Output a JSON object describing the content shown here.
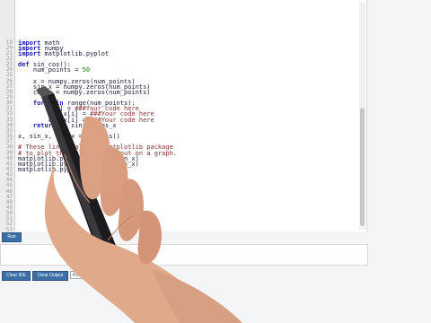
{
  "editor": {
    "lines": [
      {
        "n": "19",
        "parts": [
          {
            "t": "import",
            "k": "kw"
          },
          {
            "t": " math"
          }
        ]
      },
      {
        "n": "20",
        "parts": [
          {
            "t": "import",
            "k": "kw"
          },
          {
            "t": " numpy"
          }
        ]
      },
      {
        "n": "21",
        "parts": [
          {
            "t": "import",
            "k": "kw"
          },
          {
            "t": " matplotlib.pyplot"
          }
        ]
      },
      {
        "n": "22",
        "parts": []
      },
      {
        "n": "23",
        "parts": [
          {
            "t": "def",
            "k": "kw"
          },
          {
            "t": " sin_cos():"
          }
        ]
      },
      {
        "n": "24",
        "parts": [
          {
            "t": "    num_points = "
          },
          {
            "t": "50",
            "k": "num"
          }
        ]
      },
      {
        "n": "25",
        "parts": []
      },
      {
        "n": "26",
        "parts": [
          {
            "t": "    x = numpy.zeros(num_points)"
          }
        ]
      },
      {
        "n": "27",
        "parts": [
          {
            "t": "    sin_x = numpy.zeros(num_points)"
          }
        ]
      },
      {
        "n": "28",
        "parts": [
          {
            "t": "    cos_x = numpy.zeros(num_points)"
          }
        ]
      },
      {
        "n": "29",
        "parts": []
      },
      {
        "n": "30",
        "parts": [
          {
            "t": "    "
          },
          {
            "t": "for",
            "k": "kw"
          },
          {
            "t": " i "
          },
          {
            "t": "in",
            "k": "kw"
          },
          {
            "t": " range(num_points):"
          }
        ]
      },
      {
        "n": "31",
        "parts": [
          {
            "t": "        x[i] = "
          },
          {
            "t": "###Your code here",
            "k": "cm"
          }
        ]
      },
      {
        "n": "32",
        "parts": [
          {
            "t": "        sin_x[i] = "
          },
          {
            "t": "###Your code here",
            "k": "cm"
          }
        ]
      },
      {
        "n": "33",
        "parts": [
          {
            "t": "        cos_x[i] = "
          },
          {
            "t": "###Your code here",
            "k": "cm"
          }
        ]
      },
      {
        "n": "34",
        "parts": [
          {
            "t": "    "
          },
          {
            "t": "return",
            "k": "kw"
          },
          {
            "t": " x, sin_x, cos_x"
          }
        ]
      },
      {
        "n": "35",
        "parts": []
      },
      {
        "n": "36",
        "parts": [
          {
            "t": "x, sin_x, cos_x = sin_cos()"
          }
        ]
      },
      {
        "n": "37",
        "parts": []
      },
      {
        "n": "38",
        "parts": [
          {
            "t": "# These lines call the matplotlib package",
            "k": "cm"
          }
        ]
      },
      {
        "n": "39",
        "parts": [
          {
            "t": "# to plot the values you input on a graph.",
            "k": "cm"
          }
        ]
      },
      {
        "n": "40",
        "parts": [
          {
            "t": "matplotlib.pyplot.plot(x, sin_x)"
          }
        ]
      },
      {
        "n": "41",
        "parts": [
          {
            "t": "matplotlib.pyplot.plot(x, cos_x)"
          }
        ]
      },
      {
        "n": "42",
        "parts": [
          {
            "t": "matplotlib.pyplot.show()"
          }
        ]
      },
      {
        "n": "43",
        "parts": []
      },
      {
        "n": "44",
        "parts": []
      },
      {
        "n": "45",
        "parts": []
      },
      {
        "n": "46",
        "parts": []
      },
      {
        "n": "47",
        "parts": []
      },
      {
        "n": "48",
        "parts": []
      },
      {
        "n": "49",
        "parts": []
      },
      {
        "n": "50",
        "parts": []
      },
      {
        "n": "51",
        "parts": []
      },
      {
        "n": "52",
        "parts": []
      },
      {
        "n": "53",
        "parts": []
      }
    ]
  },
  "toolbar": {
    "run_label": "Run",
    "clear_ide_label": "Clear IDE",
    "clear_output_label": "Clear Output",
    "sample_placeholder": "Pick a sample..."
  },
  "colors": {
    "button_bg": "#3d6fa6",
    "keyword": "#1b1bb0",
    "comment": "#8a3030"
  }
}
